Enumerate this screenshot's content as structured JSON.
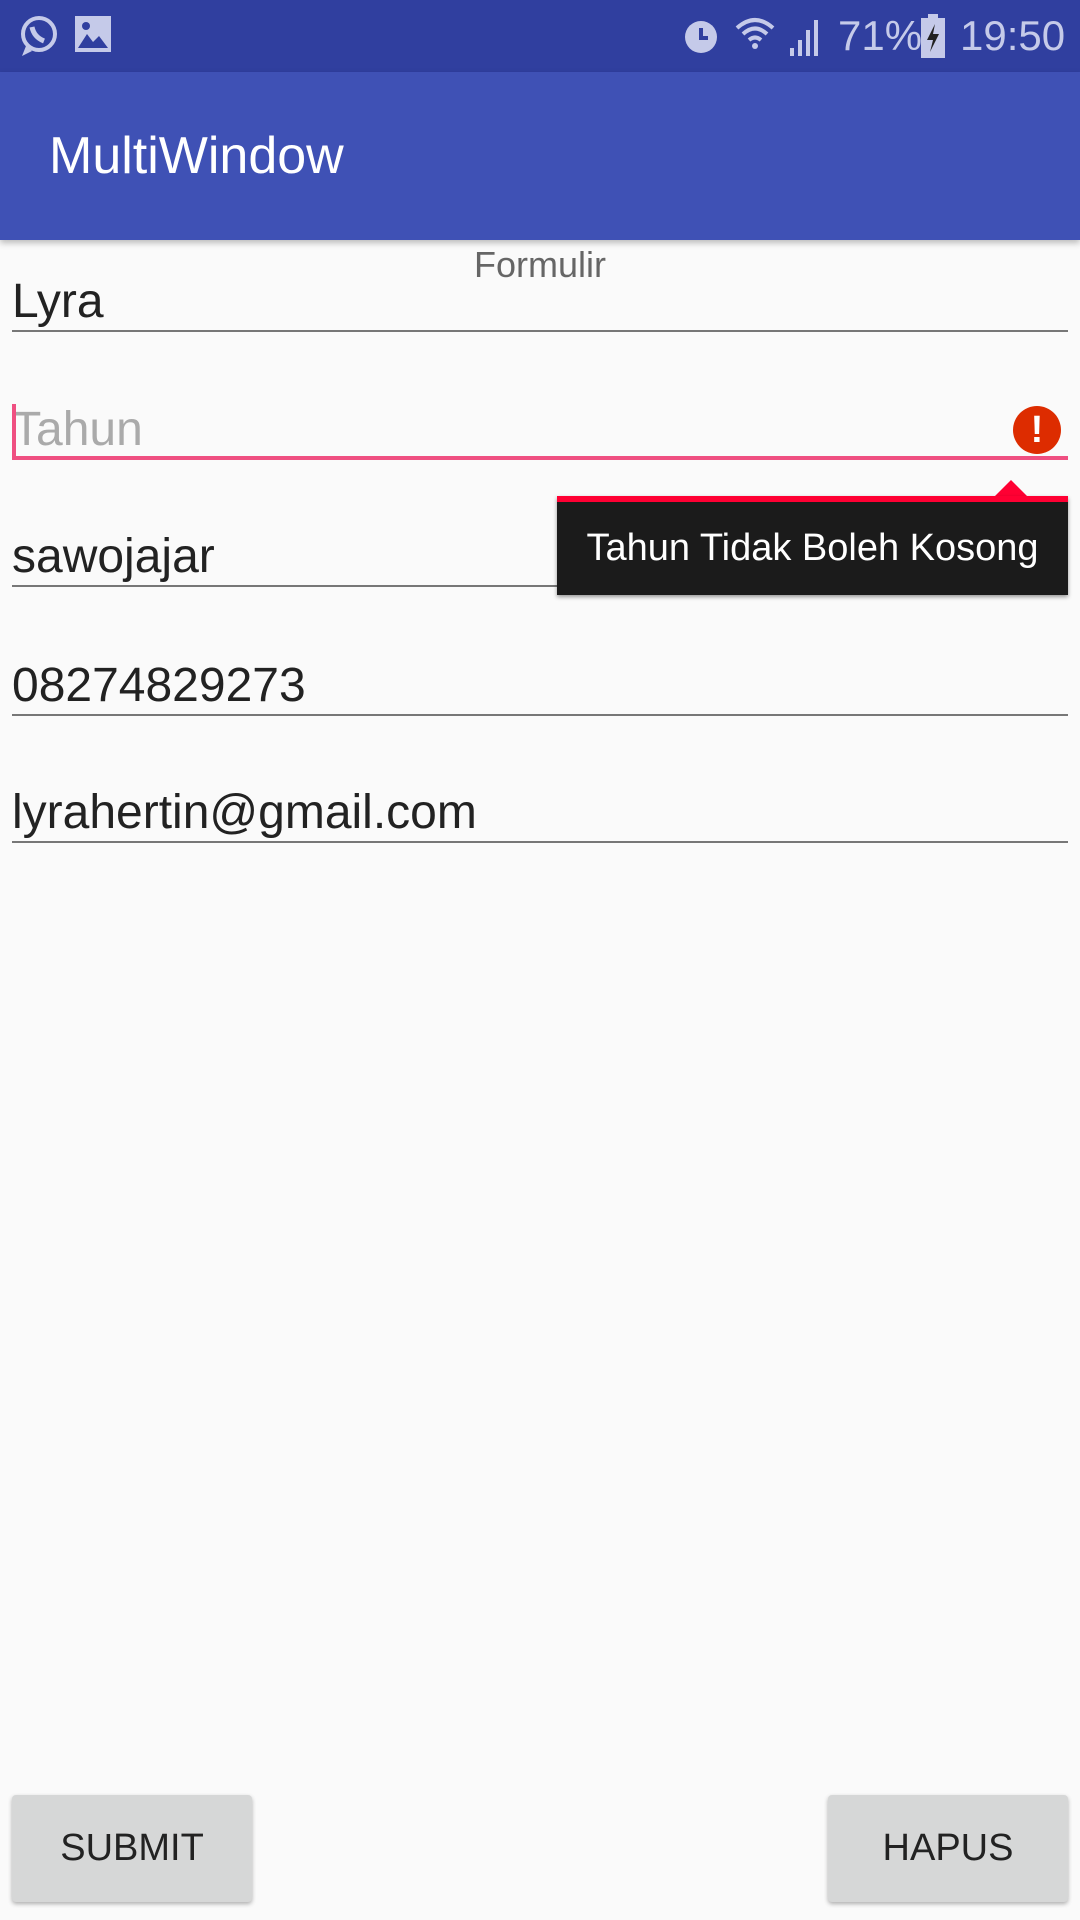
{
  "status_bar": {
    "battery": "71%",
    "time": "19:50",
    "icons": [
      "whatsapp-icon",
      "gallery-icon",
      "alarm-icon",
      "wifi-icon",
      "signal-icon",
      "battery-charging-icon"
    ]
  },
  "app_bar": {
    "title": "MultiWindow"
  },
  "form": {
    "title": "Formulir",
    "name_value": "Lyra",
    "year_placeholder": "Tahun",
    "year_error": "Tahun Tidak Boleh Kosong",
    "address_value": "sawojajar",
    "phone_value": "08274829273",
    "email_value": "lyrahertin@gmail.com"
  },
  "buttons": {
    "submit": "SUBMIT",
    "clear": "HAPUS"
  },
  "colors": {
    "status": "#303f9f",
    "primary": "#3f51b5",
    "accent": "#ef4f81",
    "error": "#dd2c00"
  }
}
